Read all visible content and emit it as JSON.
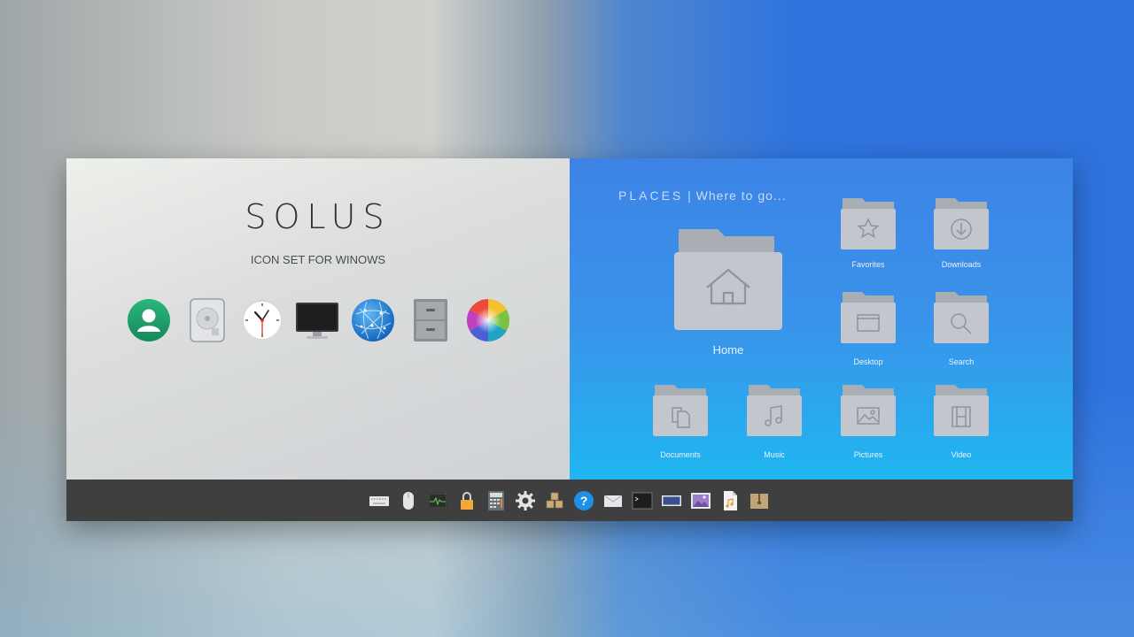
{
  "left": {
    "title": "SOLUS",
    "subtitle": "ICON SET FOR WINOWS",
    "icons": [
      {
        "name": "user-accounts-icon",
        "color": "#1f9e6a"
      },
      {
        "name": "hard-drive-icon",
        "color": "#dcdde0"
      },
      {
        "name": "clock-icon",
        "color": "#ffffff"
      },
      {
        "name": "monitor-icon",
        "color": "#2b2b2b"
      },
      {
        "name": "network-globe-icon",
        "color": "#1e7fd6"
      },
      {
        "name": "file-cabinet-icon",
        "color": "#8c9096"
      },
      {
        "name": "color-wheel-icon",
        "color": "#e8463a"
      }
    ]
  },
  "places": {
    "heading_caps": "PLACES",
    "heading_rest": " | Where to go...",
    "folders": [
      {
        "label": "Home",
        "icon": "home-icon"
      },
      {
        "label": "Favorites",
        "icon": "star-icon"
      },
      {
        "label": "Downloads",
        "icon": "download-icon"
      },
      {
        "label": "Desktop",
        "icon": "window-icon"
      },
      {
        "label": "Search",
        "icon": "search-icon"
      },
      {
        "label": "Documents",
        "icon": "documents-icon"
      },
      {
        "label": "Music",
        "icon": "music-note-icon"
      },
      {
        "label": "Pictures",
        "icon": "picture-icon"
      },
      {
        "label": "Video",
        "icon": "film-icon"
      }
    ],
    "folder_color": "#c3c6cc"
  },
  "taskbar": {
    "icons": [
      "keyboard-icon",
      "mouse-icon",
      "system-monitor-icon",
      "lock-icon",
      "calculator-icon",
      "settings-gear-icon",
      "packages-icon",
      "help-icon",
      "mail-icon",
      "terminal-icon",
      "display-icon",
      "image-viewer-icon",
      "audio-file-icon",
      "archive-icon"
    ],
    "background": "#3f3f3f"
  }
}
